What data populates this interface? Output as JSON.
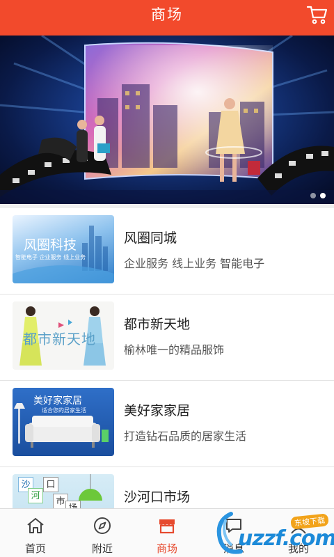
{
  "header": {
    "title": "商场",
    "cart_icon": "shopping-cart-icon"
  },
  "banner": {
    "slide_count": 2,
    "active_slide": 2
  },
  "stores": [
    {
      "title": "风圈同城",
      "subtitle": "企业服务 线上业务 智能电子",
      "thumb": {
        "heading": "风圈科技",
        "tagline": "智能电子  企业服务  线上业务"
      }
    },
    {
      "title": "都市新天地",
      "subtitle": "榆林唯一的精品服饰",
      "thumb": {
        "heading": "都市新天地"
      }
    },
    {
      "title": "美好家家居",
      "subtitle": "打造钻石品质的居家生活",
      "thumb": {
        "heading": "美好家家居",
        "tagline": "适合您的居家生活"
      }
    },
    {
      "title": "沙河口市场",
      "subtitle": "",
      "thumb": {
        "chars": [
          "沙",
          "口",
          "河",
          "市",
          "场"
        ]
      }
    }
  ],
  "tabs": [
    {
      "label": "首页",
      "icon": "home-icon",
      "active": false
    },
    {
      "label": "附近",
      "icon": "compass-icon",
      "active": false
    },
    {
      "label": "商场",
      "icon": "store-icon",
      "active": true
    },
    {
      "label": "消息",
      "icon": "message-icon",
      "active": false
    },
    {
      "label": "我的",
      "icon": "user-icon",
      "active": false
    }
  ],
  "watermark": {
    "text": "uzzf.com",
    "badge": "东坡下载"
  },
  "colors": {
    "accent": "#f24a2c",
    "tab_active": "#e64a2e"
  }
}
